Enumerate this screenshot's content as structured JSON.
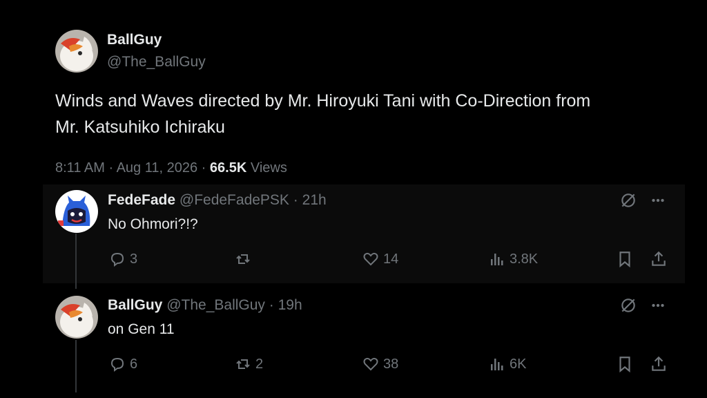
{
  "main_post": {
    "display_name": "BallGuy",
    "handle": "@The_BallGuy",
    "text_line1": "Winds and Waves directed by Mr. Hiroyuki Tani with Co-Direction from",
    "text_line2": "Mr. Katsuhiko Ichiraku",
    "time": "8:11 AM",
    "date": "Aug 11, 2026",
    "views_count": "66.5K",
    "views_label": "Views",
    "separator": "·"
  },
  "replies": [
    {
      "display_name": "FedeFade",
      "handle": "@FedeFadePSK",
      "age": "21h",
      "text": "No Ohmori?!?",
      "reply_count": "3",
      "repost_count": "",
      "like_count": "14",
      "view_count": "3.8K",
      "separator": "·"
    },
    {
      "display_name": "BallGuy",
      "handle": "@The_BallGuy",
      "age": "19h",
      "text": "on Gen 11",
      "reply_count": "6",
      "repost_count": "2",
      "like_count": "38",
      "view_count": "6K",
      "separator": "·"
    }
  ],
  "icons": [
    "grok-icon",
    "more-icon",
    "reply-icon",
    "repost-icon",
    "like-icon",
    "views-icon",
    "bookmark-icon",
    "share-icon"
  ],
  "colors": {
    "background": "#000000",
    "text": "#e7e9ea",
    "muted": "#71767b"
  }
}
